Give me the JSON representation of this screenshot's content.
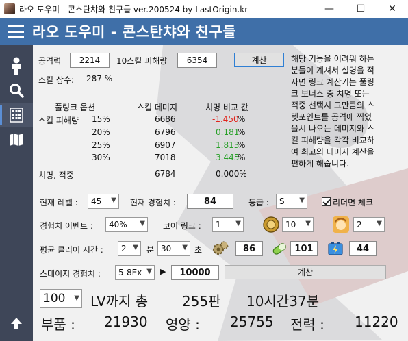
{
  "window": {
    "title": "라오 도우미 - 콘스탄챠와 친구들 ver.200524 by LastOrigin.kr",
    "minimize": "—",
    "maximize": "☐",
    "close": "✕"
  },
  "header": {
    "title": "라오 도우미 - 콘스탄챠와 친구들"
  },
  "sidebar": {
    "items": [
      {
        "name": "person-icon"
      },
      {
        "name": "search-icon"
      },
      {
        "name": "calculator-icon"
      },
      {
        "name": "map-icon"
      },
      {
        "name": "arrow-up-icon"
      }
    ]
  },
  "damage": {
    "attack_label": "공격력",
    "attack_value": "2214",
    "skill10_label": "10스킬 피해량",
    "skill10_value": "6354",
    "calc_button": "계산",
    "skill_const_label": "스킬 상수:",
    "skill_const_value": "287 %",
    "description": "해당 기능을 어려워 하는 분들이 계셔서 설명을 적자면 링크 계산기는 풀링크 보너스 중 치명 또는 적중 선택시 그만큼의 스텟포인트를 공격에 찍었을시 나오는 데미지와 스킬 피해량을 각각 비교하여 최고의 데미지 계산을 편하게 해줍니다.",
    "description_lines": [
      "해당 기능을 어려워 하는",
      "분들이 계셔서 설명을 적",
      "자면 링크 계산기는 풀링",
      "크 보너스 중 치명 또는",
      "적중 선택시 그만큼의 스",
      "텟포인트를 공격에 찍었",
      "을시 나오는 데미지와 스",
      "킬 피해량을 각각 비교하",
      "여 최고의 데미지 계산을",
      "편하게 해줍니다."
    ],
    "table_headers": [
      "풀링크 옵션",
      "스킬 데미지",
      "치명 비교 값"
    ],
    "row_label": "스킬 피해량",
    "rows": [
      {
        "option": "15%",
        "damage": "6686",
        "compare": "-1.450",
        "unit": "%"
      },
      {
        "option": "20%",
        "damage": "6796",
        "compare": "0.181",
        "unit": "%"
      },
      {
        "option": "25%",
        "damage": "6907",
        "compare": "1.813",
        "unit": "%"
      },
      {
        "option": "30%",
        "damage": "7018",
        "compare": "3.445",
        "unit": "%"
      }
    ],
    "crit_label": "치명, 적중",
    "crit_damage": "6784",
    "crit_compare": "0.000%"
  },
  "exp": {
    "level_label": "현재 레벨 :",
    "level_value": "45",
    "current_exp_label": "현재 경험치 :",
    "current_exp_value": "84",
    "grade_label": "등급 :",
    "grade_value": "S",
    "leader_label": "리더면 체크",
    "event_label": "경험치 이벤트 :",
    "event_value": "40%",
    "core_link_label": "코어 링크 :",
    "core_link_value": "1",
    "core_count": "10",
    "bonus_count": "2",
    "clear_time_label": "평균 클리어 시간 :",
    "minutes": "2",
    "minute_unit": "분",
    "seconds": "30",
    "second_unit": "초",
    "parts_stock": "86",
    "nutrient_stock": "101",
    "power_stock": "44",
    "stage_label": "스테이지 경험치 :",
    "stage_value": "5-8Ex",
    "play_glyph": "▶",
    "stage_exp": "10000",
    "calc_button": "계산"
  },
  "result": {
    "target_level": "100",
    "line1_a": "LV까지 총",
    "runs": "255판",
    "time": "10시간37분",
    "parts_label": "부품 :",
    "parts_value": "21930",
    "nutrient_label": "영양 :",
    "nutrient_value": "25755",
    "power_label": "전력 :",
    "power_value": "11220"
  },
  "colors": {
    "header": "#3f6fa8",
    "sidebar": "#3e4658",
    "negative": "#e2231a",
    "positive": "#28a028"
  }
}
